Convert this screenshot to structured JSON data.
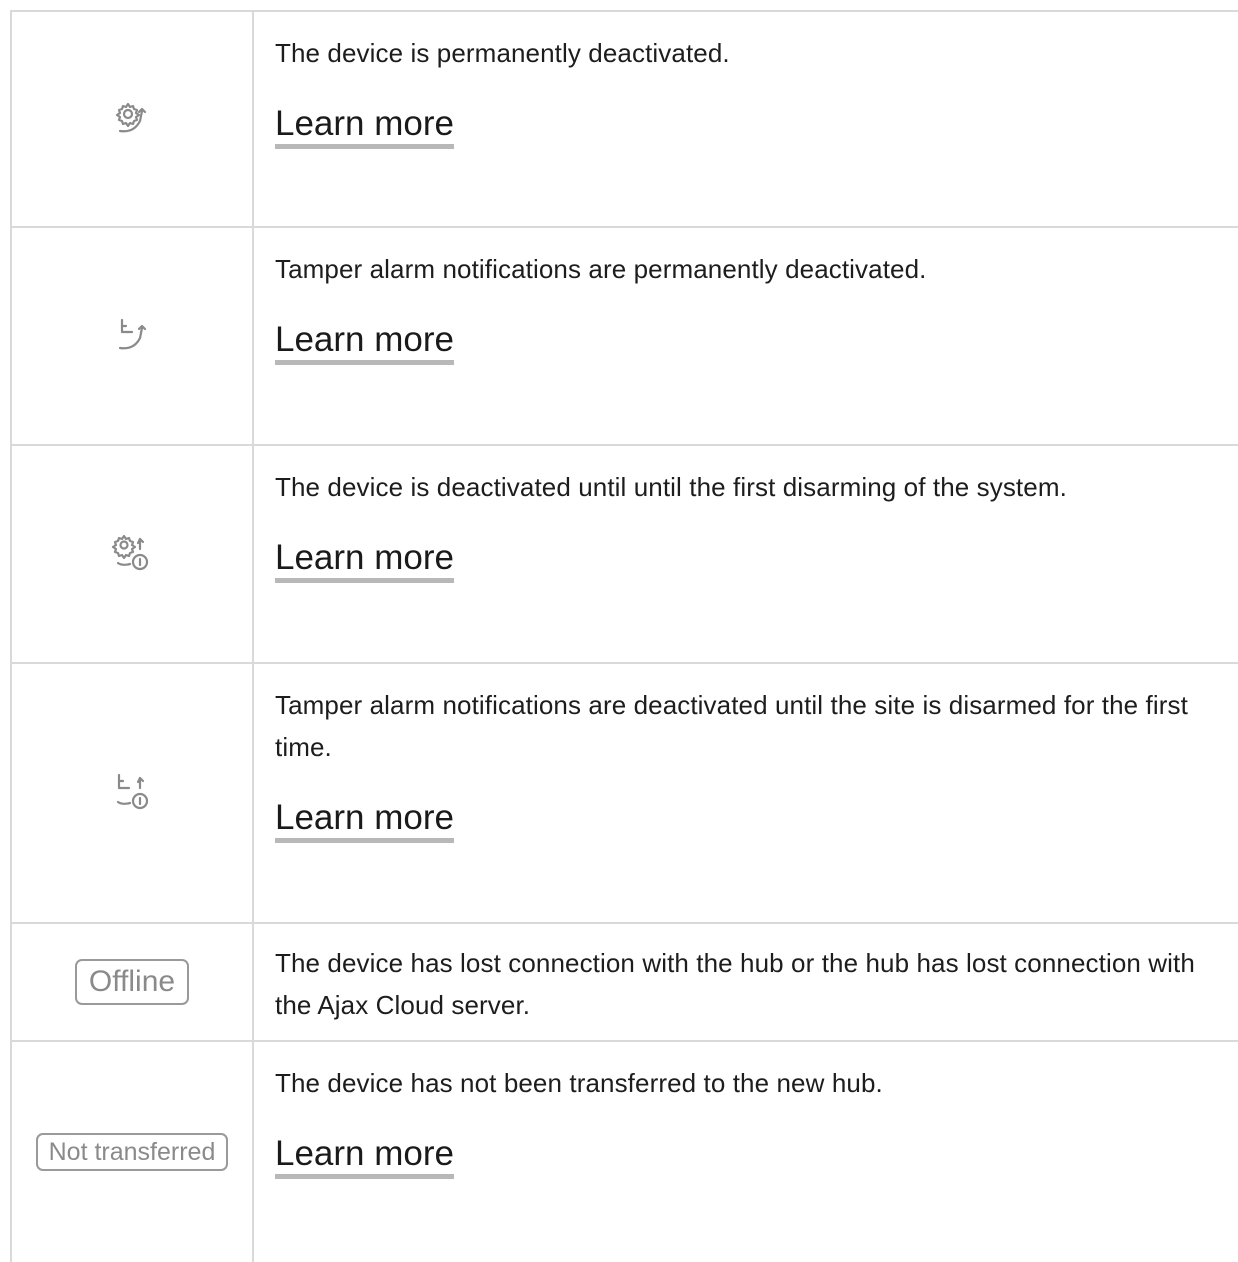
{
  "rows": [
    {
      "icon": "gear-arrow-icon",
      "description": "The device is permanently deactivated.",
      "link": "Learn more"
    },
    {
      "icon": "tamper-arrow-icon",
      "description": "Tamper alarm notifications are permanently deactivated.",
      "link": "Learn more"
    },
    {
      "icon": "gear-arrow-once-icon",
      "description": "The device is deactivated until until the first disarming of the system.",
      "link": "Learn more"
    },
    {
      "icon": "tamper-arrow-once-icon",
      "description": "Tamper alarm notifications are deactivated until the site is disarmed for the first time.",
      "link": "Learn more"
    },
    {
      "badge": "Offline",
      "description": "The device has lost connection with the hub or the hub has lost connection with the Ajax Cloud server."
    },
    {
      "badge": "Not transferred",
      "description": "The device has not been transferred to the new hub.",
      "link": "Learn more"
    }
  ],
  "colors": {
    "border": "#d9d9d9",
    "icon": "#8a8a8a",
    "link_underline": "#b8b8b8",
    "text": "#1d1d1d"
  }
}
